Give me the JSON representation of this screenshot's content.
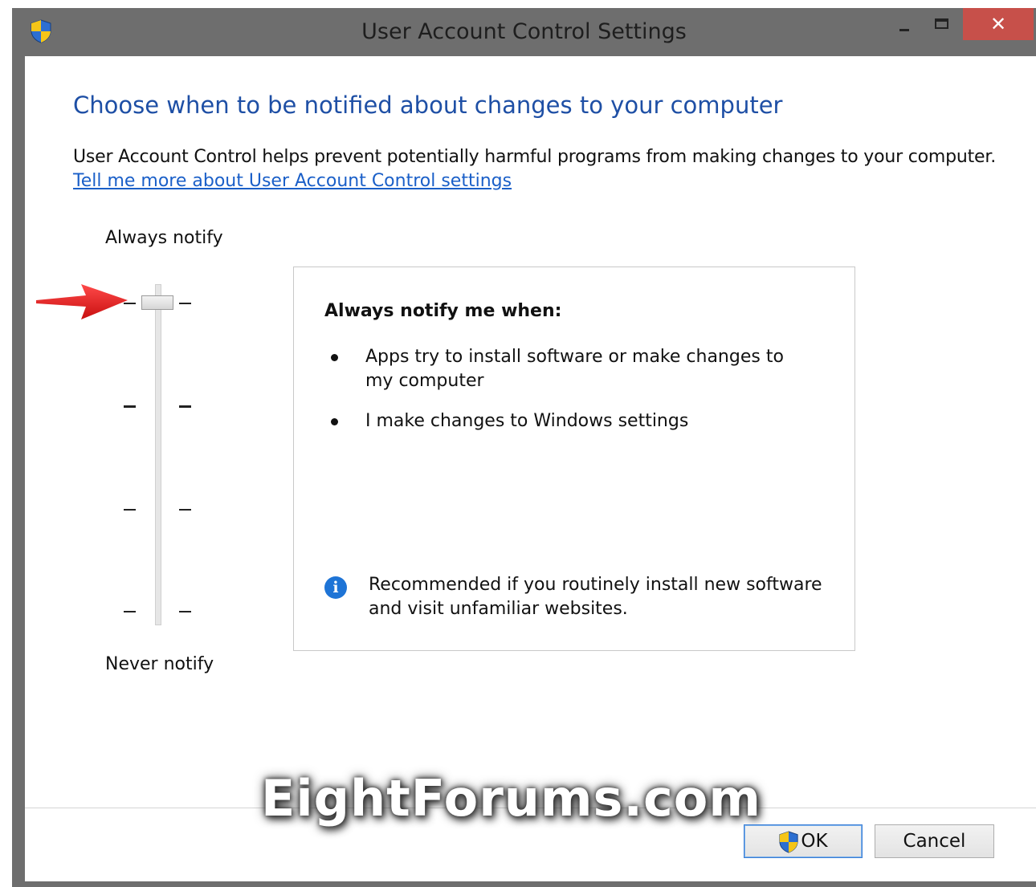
{
  "window": {
    "title": "User Account Control Settings",
    "close_glyph": "✕"
  },
  "content": {
    "heading": "Choose when to be notified about changes to your computer",
    "description": "User Account Control helps prevent potentially harmful programs from making changes to your computer.",
    "learn_more_link": "Tell me more about User Account Control settings"
  },
  "slider": {
    "top_label": "Always notify",
    "bottom_label": "Never notify",
    "levels": 4,
    "selected_level": 4
  },
  "panel": {
    "heading": "Always notify me when:",
    "bullets": [
      "Apps try to install software or make changes to my computer",
      "I make changes to Windows settings"
    ],
    "info_icon_glyph": "i",
    "recommendation": "Recommended if you routinely install new software and visit unfamiliar websites."
  },
  "buttons": {
    "ok": "OK",
    "cancel": "Cancel"
  },
  "watermark": "EightForums.com",
  "icons": {
    "app": "uac-shield-icon",
    "ok": "uac-shield-icon",
    "info": "info-icon",
    "annotation": "red-arrow-icon"
  },
  "colors": {
    "heading": "#1e4fa5",
    "link": "#1a5fc8",
    "close_button": "#c7504a",
    "info_icon": "#1e74d6",
    "annotation_arrow": "#e01919"
  }
}
